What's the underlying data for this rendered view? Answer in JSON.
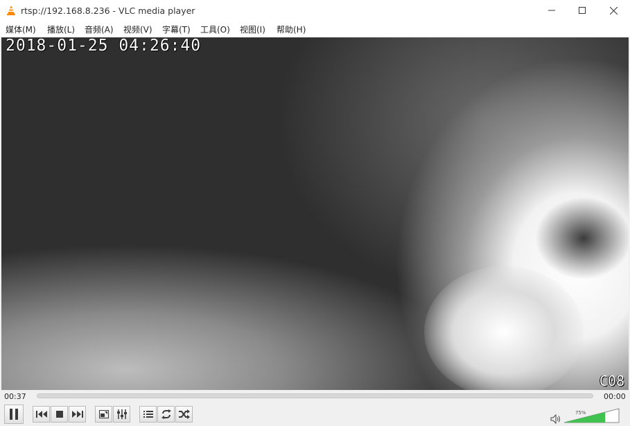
{
  "window": {
    "title": "rtsp://192.168.8.236 - VLC media player"
  },
  "menu": [
    "媒体(M)",
    "播放(L)",
    "音频(A)",
    "视频(V)",
    "字幕(T)",
    "工具(O)",
    "视图(I)",
    "帮助(H)"
  ],
  "osd": {
    "timestamp": "2018-01-25 04:26:40",
    "camera_code": "C08"
  },
  "playback": {
    "elapsed": "00:37",
    "total": "00:00",
    "progress": 0
  },
  "volume": {
    "label": "75%",
    "level": 0.75
  },
  "icons": [
    "vlc-cone-icon",
    "minimize-icon",
    "maximize-icon",
    "close-icon",
    "pause-icon",
    "previous-icon",
    "stop-icon",
    "next-icon",
    "fullscreen-icon",
    "extended-settings-icon",
    "playlist-icon",
    "loop-icon",
    "shuffle-icon",
    "speaker-icon"
  ],
  "colors": {
    "accent": "#ff8800",
    "volume_fill": "#3fc24f"
  }
}
